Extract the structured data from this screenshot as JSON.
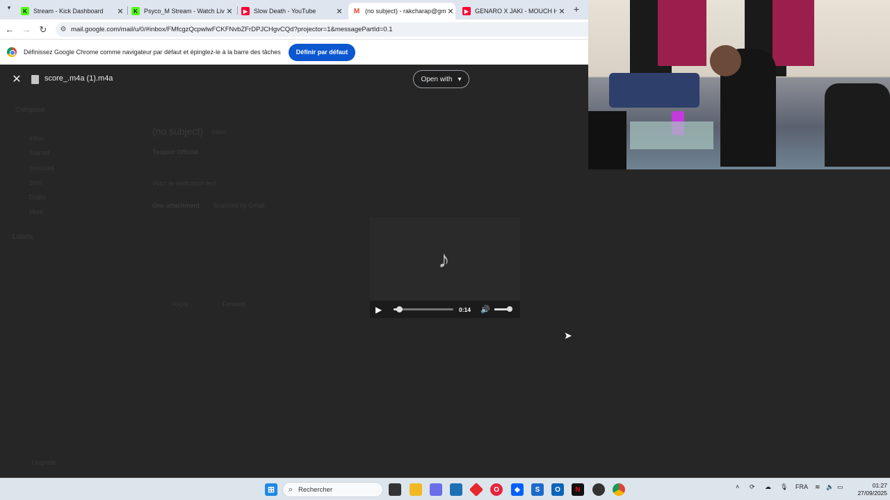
{
  "browser": {
    "tabs": [
      {
        "title": "Stream - Kick Dashboard",
        "icon": "kick-icon",
        "color": "#53fc18"
      },
      {
        "title": "Psyco_M Stream - Watch Live o",
        "icon": "kick-icon",
        "color": "#53fc18"
      },
      {
        "title": "Slow Death - YouTube",
        "icon": "youtube-icon",
        "color": "#ff0033"
      },
      {
        "title": "(no subject) - rakcharap@gmai",
        "icon": "gmail-icon",
        "color": "#ea4335"
      },
      {
        "title": "GENARO X JAKI - MOUCH HUM",
        "icon": "youtube-icon",
        "color": "#ff0033"
      }
    ],
    "url": "mail.google.com/mail/u/0/#inbox/FMfcgzQcpwlwFCKFNvbZFrDPJCHgvCQd?projector=1&messagePartId=0.1"
  },
  "infobar": {
    "message": "Définissez Google Chrome comme navigateur par défaut et épinglez-le à la barre des tâches",
    "button": "Définir par défaut"
  },
  "viewer": {
    "filename": "score_.m4a (1).m4a",
    "open_with": "Open with",
    "player": {
      "time": "0:14",
      "progress": 0.1,
      "volume": 0.85
    }
  },
  "gmail_background": {
    "compose": "Compose",
    "nav": [
      "Inbox",
      "Starred",
      "Snoozed",
      "Sent",
      "Drafts",
      "More"
    ],
    "labels": "Labels",
    "subject": "(no subject)",
    "inbox_tag": "Inbox",
    "sender": "Toujour Official",
    "body": "Voici: le dedication text",
    "attachment": "One attachment",
    "scanned": "Scanned by Gmail",
    "reply": "Reply",
    "forward": "Forward",
    "upgrade": "Upgrade"
  },
  "taskbar": {
    "search_placeholder": "Rechercher",
    "language": "FRA",
    "time": "01:27",
    "date": "27/09/2025"
  }
}
